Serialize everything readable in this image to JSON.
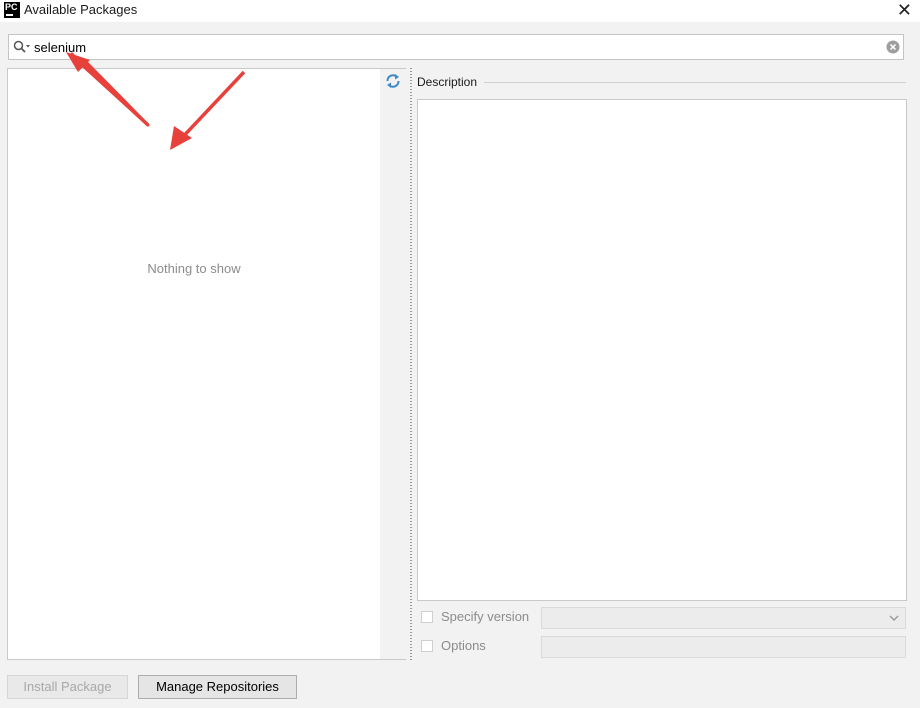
{
  "window": {
    "title": "Available Packages",
    "app_icon_text": "PC",
    "close_glyph": "✕"
  },
  "search": {
    "value": "selenium",
    "icon": "search-icon",
    "clear_icon": "clear-icon"
  },
  "package_list": {
    "empty_text": "Nothing to show",
    "refresh_icon": "refresh-icon"
  },
  "description": {
    "label": "Description"
  },
  "options": {
    "specify_version_label": "Specify version",
    "specify_version_checked": false,
    "options_label": "Options",
    "options_checked": false
  },
  "buttons": {
    "install": "Install Package",
    "manage": "Manage Repositories"
  },
  "annotation": {
    "arrow_color": "#e8413c"
  }
}
